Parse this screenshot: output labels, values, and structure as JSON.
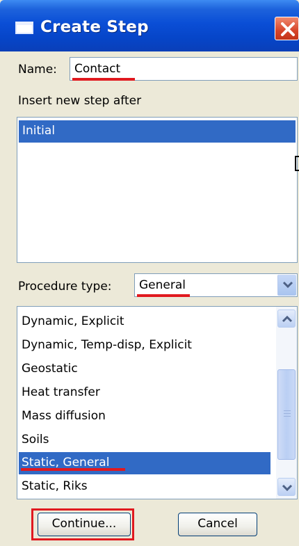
{
  "window": {
    "title": "Create Step",
    "close_icon": "close-icon",
    "accent": "#0a4ed6"
  },
  "name": {
    "label": "Name:",
    "value": "Contact"
  },
  "insert": {
    "label": "Insert new step after",
    "items": [
      {
        "label": "Initial",
        "selected": true
      }
    ]
  },
  "procedure": {
    "label": "Procedure type:",
    "value": "General",
    "items": [
      {
        "label": "Dynamic, Explicit"
      },
      {
        "label": "Dynamic, Temp-disp, Explicit"
      },
      {
        "label": "Geostatic"
      },
      {
        "label": "Heat transfer"
      },
      {
        "label": "Mass diffusion"
      },
      {
        "label": "Soils"
      },
      {
        "label": "Static, General",
        "selected": true
      },
      {
        "label": "Static, Riks"
      }
    ]
  },
  "buttons": {
    "continue": "Continue...",
    "cancel": "Cancel"
  },
  "annotation_color": "#e0191f",
  "selection_color": "#316ac5"
}
